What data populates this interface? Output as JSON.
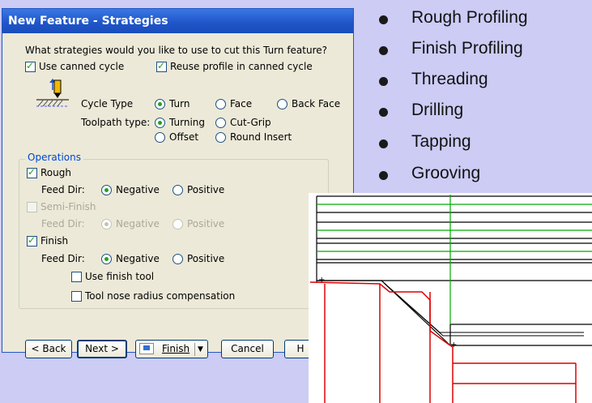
{
  "dialog": {
    "title": "New Feature - Strategies",
    "prompt": "What strategies would you like to use to cut this Turn feature?",
    "use_canned_cycle": {
      "label": "Use canned cycle",
      "checked": true
    },
    "reuse_profile": {
      "label": "Reuse profile in canned cycle",
      "checked": true
    },
    "cycle_type": {
      "label": "Cycle Type",
      "options": [
        "Turn",
        "Face",
        "Back Face"
      ],
      "selected": "Turn"
    },
    "toolpath_type": {
      "label": "Toolpath type:",
      "options": [
        "Turning",
        "Cut-Grip",
        "Offset",
        "Round Insert"
      ],
      "selected": "Turning"
    },
    "operations": {
      "label": "Operations",
      "feed_dir_label": "Feed Dir:",
      "negative": "Negative",
      "positive": "Positive",
      "rough": {
        "label": "Rough",
        "checked": true,
        "feed_dir": "Negative"
      },
      "semi_finish": {
        "label": "Semi-Finish",
        "checked": false,
        "enabled": false,
        "feed_dir": "Negative"
      },
      "finish": {
        "label": "Finish",
        "checked": true,
        "feed_dir": "Negative"
      },
      "use_finish_tool": {
        "label": "Use finish tool",
        "checked": false
      },
      "tool_nose": {
        "label": "Tool nose radius compensation",
        "checked": false
      }
    },
    "buttons": {
      "back": "< Back",
      "next": "Next >",
      "finish": "Finish",
      "cancel": "Cancel",
      "help": "H"
    }
  },
  "bullets": [
    "Rough Profiling",
    "Finish Profiling",
    "Threading",
    "Drilling",
    "Tapping",
    "Grooving"
  ],
  "colors": {
    "title_bar": "#1f54c8",
    "toolpath_green": "#00aa00",
    "toolpath_red": "#dd0000",
    "background": "#ccccf5"
  }
}
